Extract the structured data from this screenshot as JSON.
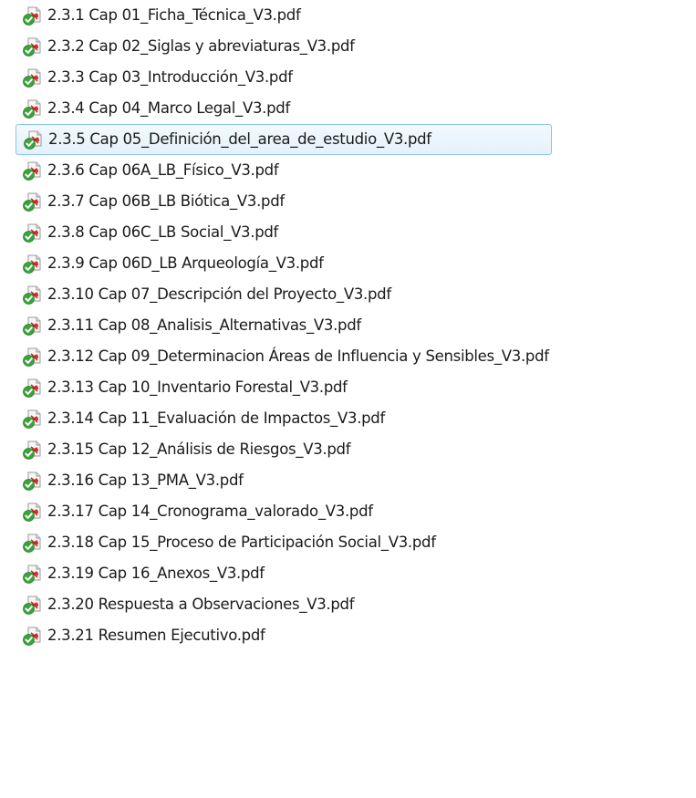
{
  "explorer": {
    "hover_index": 4,
    "colors": {
      "hover_border": "#8ec2ea",
      "hover_fill": "#e4f1fc",
      "pdf_red": "#c8201c",
      "sync_green": "#3aa33a"
    },
    "items": [
      {
        "name": "2.3.1 Cap 01_Ficha_Técnica_V3.pdf",
        "icon": "pdf-sync-ok-icon"
      },
      {
        "name": "2.3.2 Cap 02_Siglas y abreviaturas_V3.pdf",
        "icon": "pdf-sync-ok-icon"
      },
      {
        "name": "2.3.3 Cap 03_Introducción_V3.pdf",
        "icon": "pdf-sync-ok-icon"
      },
      {
        "name": "2.3.4 Cap 04_Marco Legal_V3.pdf",
        "icon": "pdf-sync-ok-icon"
      },
      {
        "name": "2.3.5 Cap 05_Definición_del_area_de_estudio_V3.pdf",
        "icon": "pdf-sync-ok-icon"
      },
      {
        "name": "2.3.6 Cap 06A_LB_Físico_V3.pdf",
        "icon": "pdf-sync-ok-icon"
      },
      {
        "name": "2.3.7 Cap 06B_LB Biótica_V3.pdf",
        "icon": "pdf-sync-ok-icon"
      },
      {
        "name": "2.3.8 Cap 06C_LB Social_V3.pdf",
        "icon": "pdf-sync-ok-icon"
      },
      {
        "name": "2.3.9 Cap 06D_LB Arqueología_V3.pdf",
        "icon": "pdf-sync-ok-icon"
      },
      {
        "name": "2.3.10 Cap 07_Descripción del Proyecto_V3.pdf",
        "icon": "pdf-sync-ok-icon"
      },
      {
        "name": "2.3.11 Cap 08_Analisis_Alternativas_V3.pdf",
        "icon": "pdf-sync-ok-icon"
      },
      {
        "name": "2.3.12 Cap 09_Determinacion Áreas de Influencia y Sensibles_V3.pdf",
        "icon": "pdf-sync-ok-icon"
      },
      {
        "name": "2.3.13 Cap 10_Inventario Forestal_V3.pdf",
        "icon": "pdf-sync-ok-icon"
      },
      {
        "name": "2.3.14 Cap 11_Evaluación de Impactos_V3.pdf",
        "icon": "pdf-sync-ok-icon"
      },
      {
        "name": "2.3.15 Cap 12_Análisis de Riesgos_V3.pdf",
        "icon": "pdf-sync-ok-icon"
      },
      {
        "name": "2.3.16 Cap 13_PMA_V3.pdf",
        "icon": "pdf-sync-ok-icon"
      },
      {
        "name": "2.3.17 Cap 14_Cronograma_valorado_V3.pdf",
        "icon": "pdf-sync-ok-icon"
      },
      {
        "name": "2.3.18 Cap 15_Proceso de Participación Social_V3.pdf",
        "icon": "pdf-sync-ok-icon"
      },
      {
        "name": "2.3.19 Cap 16_Anexos_V3.pdf",
        "icon": "pdf-sync-ok-icon"
      },
      {
        "name": "2.3.20 Respuesta a Observaciones_V3.pdf",
        "icon": "pdf-sync-ok-icon"
      },
      {
        "name": "2.3.21 Resumen Ejecutivo.pdf",
        "icon": "pdf-sync-ok-icon"
      }
    ]
  }
}
